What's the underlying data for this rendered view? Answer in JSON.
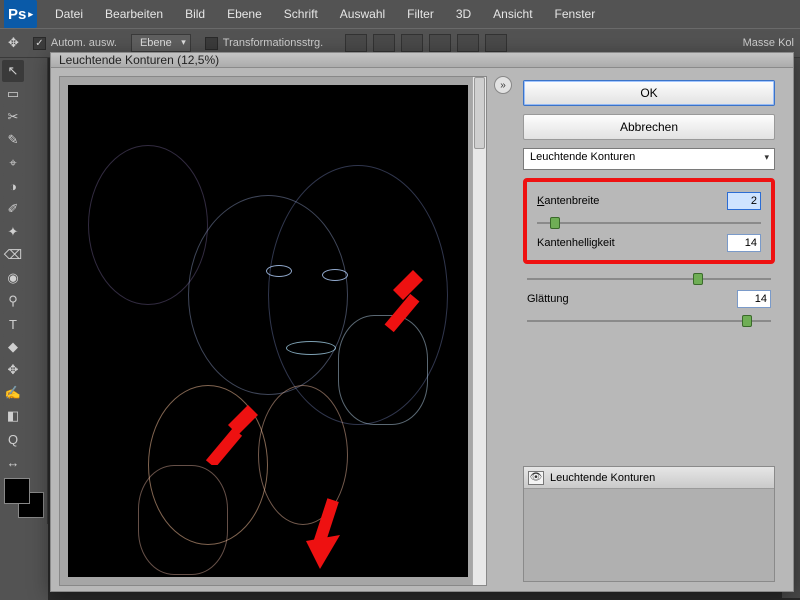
{
  "app": {
    "logo": "Ps"
  },
  "menu": {
    "items": [
      "Datei",
      "Bearbeiten",
      "Bild",
      "Ebene",
      "Schrift",
      "Auswahl",
      "Filter",
      "3D",
      "Ansicht",
      "Fenster"
    ]
  },
  "optionbar": {
    "auto_select": "Autom. ausw.",
    "layer_dd": "Ebene",
    "transform": "Transformationsstrg.",
    "right_label": "Masse Kol"
  },
  "dialog": {
    "title": "Leuchtende Konturen (12,5%)",
    "ok": "OK",
    "cancel": "Abbrechen",
    "filter_dd": "Leuchtende Konturen",
    "params": {
      "kantenbreite": {
        "label": "Kantenbreite",
        "value": "2",
        "thumb_pct": 6
      },
      "kantenhelligkeit": {
        "label": "Kantenhelligkeit",
        "value": "14",
        "thumb_pct": 68
      },
      "glaettung": {
        "label": "Glättung",
        "value": "14",
        "thumb_pct": 88
      }
    },
    "effect_row": "Leuchtende Konturen"
  },
  "tools": [
    "↖",
    "▭",
    "✂",
    "✎",
    "⌖",
    "◑",
    "✐",
    "✦",
    "⌫",
    "◉",
    "⚲",
    "T",
    "◆",
    "✥",
    "✍",
    "◧",
    "Q",
    "↔"
  ]
}
